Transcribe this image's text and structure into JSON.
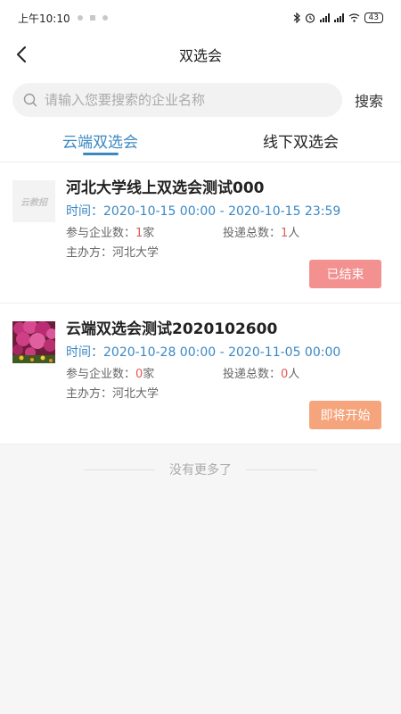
{
  "status_bar": {
    "time": "上午10:10",
    "battery": "43"
  },
  "header": {
    "title": "双选会"
  },
  "search": {
    "placeholder": "请输入您要搜索的企业名称",
    "value": "",
    "button_label": "搜索"
  },
  "tabs": [
    {
      "label": "云端双选会",
      "active": true
    },
    {
      "label": "线下双选会",
      "active": false
    }
  ],
  "events": [
    {
      "thumb_text": "云教招",
      "title": "河北大学线上双选会测试000",
      "time_label": "时间：",
      "time_range": "2020-10-15 00:00 - 2020-10-15 23:59",
      "companies_label": "参与企业数：",
      "companies_count": "1",
      "companies_unit": "家",
      "submissions_label": "投递总数：",
      "submissions_count": "1",
      "submissions_unit": "人",
      "organizer_label": "主办方：",
      "organizer": "河北大学",
      "status": "已结束"
    },
    {
      "title": "云端双选会测试2020102600",
      "time_label": "时间：",
      "time_range": "2020-10-28 00:00 - 2020-11-05 00:00",
      "companies_label": "参与企业数：",
      "companies_count": "0",
      "companies_unit": "家",
      "submissions_label": "投递总数：",
      "submissions_count": "0",
      "submissions_unit": "人",
      "organizer_label": "主办方：",
      "organizer": "河北大学",
      "status": "即将开始"
    }
  ],
  "footer": {
    "no_more": "没有更多了"
  },
  "colors": {
    "accent": "#3b88c3",
    "ended": "#f39090",
    "upcoming": "#f5a47c",
    "count": "#e05a5a"
  },
  "icons": [
    "back-arrow-icon",
    "search-icon",
    "bluetooth-icon",
    "alarm-icon",
    "signal-icon",
    "wifi-icon",
    "battery-icon"
  ]
}
